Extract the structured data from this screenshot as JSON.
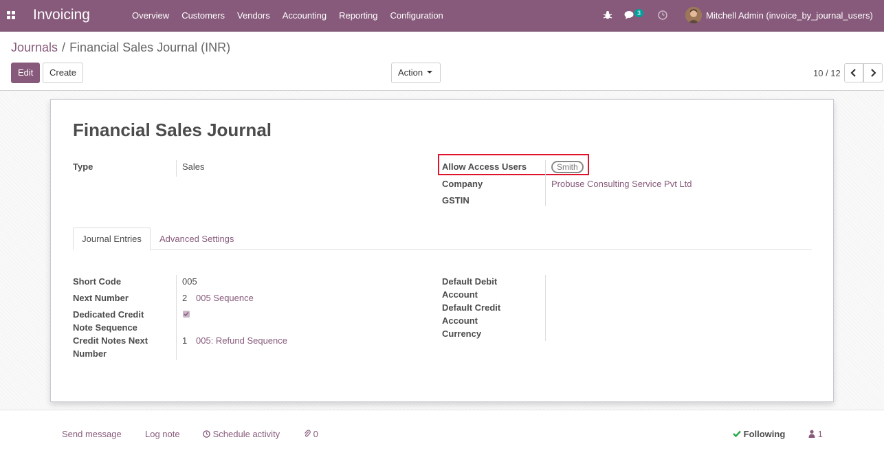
{
  "navbar": {
    "app_title": "Invoicing",
    "menu": [
      "Overview",
      "Customers",
      "Vendors",
      "Accounting",
      "Reporting",
      "Configuration"
    ],
    "message_count": "3",
    "user_name": "Mitchell Admin (invoice_by_journal_users)"
  },
  "breadcrumb": {
    "parent": "Journals",
    "separator": "/",
    "current": "Financial Sales Journal (INR)"
  },
  "toolbar": {
    "edit_label": "Edit",
    "create_label": "Create",
    "action_label": "Action",
    "pager": "10 / 12"
  },
  "form": {
    "title": "Financial Sales Journal",
    "type_label": "Type",
    "type_value": "Sales",
    "allow_access_label": "Allow Access Users",
    "allow_access_tag": "Smith",
    "company_label": "Company",
    "company_value": "Probuse Consulting Service Pvt Ltd",
    "gstin_label": "GSTIN",
    "gstin_value": ""
  },
  "tabs": {
    "journal_entries": "Journal Entries",
    "advanced_settings": "Advanced Settings"
  },
  "journal_entries": {
    "short_code_label": "Short Code",
    "short_code_value": "005",
    "next_number_label": "Next Number",
    "next_number_value": "2",
    "next_number_sequence": "005 Sequence",
    "dedicated_credit_label_line1": "Dedicated Credit",
    "dedicated_credit_label_line2": "Note Sequence",
    "dedicated_credit_checked": true,
    "credit_next_label_line1": "Credit Notes Next",
    "credit_next_label_line2": "Number",
    "credit_next_value": "1",
    "credit_next_sequence": "005: Refund Sequence",
    "default_debit_label_line1": "Default Debit",
    "default_debit_label_line2": "Account",
    "default_credit_label_line1": "Default Credit",
    "default_credit_label_line2": "Account",
    "currency_label": "Currency"
  },
  "chatter": {
    "send_message": "Send message",
    "log_note": "Log note",
    "schedule_activity": "Schedule activity",
    "attachments_count": "0",
    "following": "Following",
    "followers_count": "1"
  },
  "colors": {
    "brand": "#875a7b",
    "highlight": "#e0112b",
    "badge": "#00a09d",
    "following_check": "#28a745"
  }
}
